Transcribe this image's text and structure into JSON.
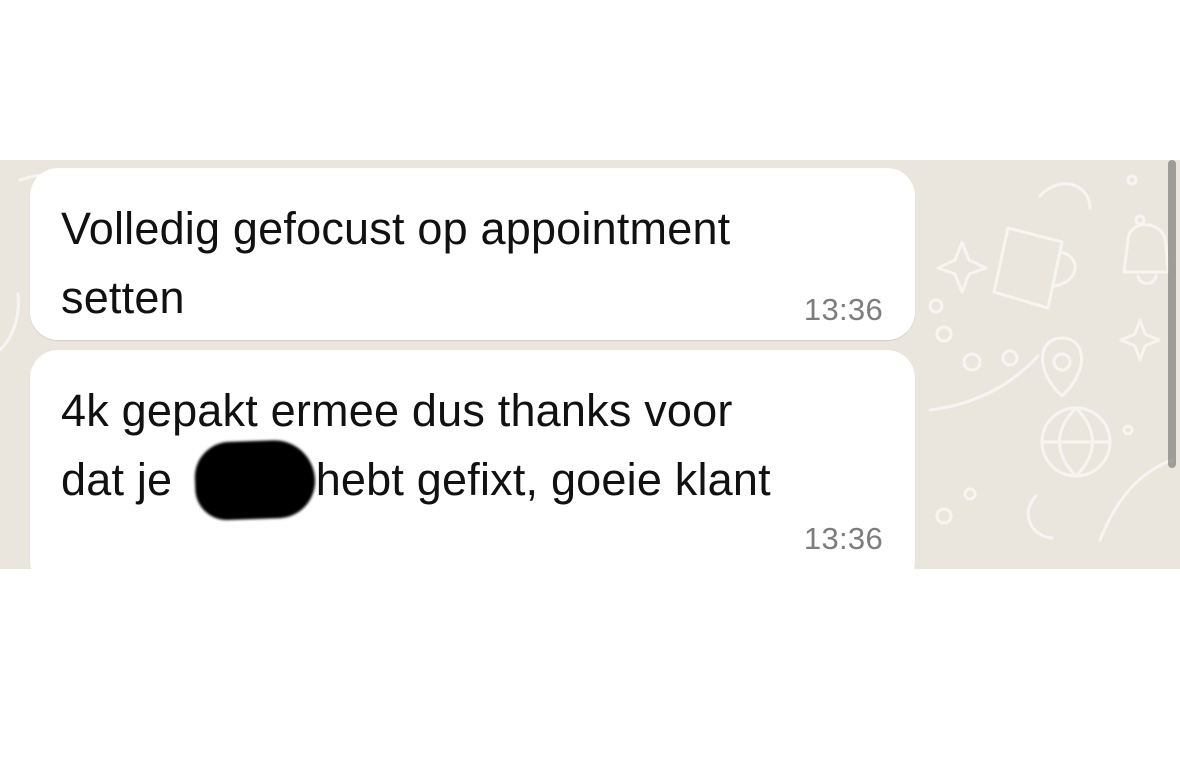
{
  "messages": [
    {
      "lines": [
        "Volledig gefocust op appointment",
        "setten"
      ],
      "time": "13:36"
    },
    {
      "lines": [
        "4k gepakt ermee dus thanks voor",
        "dat je",
        "hebt gefixt, goeie klant"
      ],
      "time": "13:36"
    }
  ],
  "colors": {
    "chat_background": "#ebe6dd",
    "bubble": "#ffffff",
    "message_text": "#111111",
    "timestamp": "#7d7d7d",
    "redaction": "#000000"
  },
  "icons": [
    "cup-icon",
    "star-icon",
    "bell-icon",
    "basketball-icon",
    "map-pin-icon",
    "dots-icon"
  ]
}
